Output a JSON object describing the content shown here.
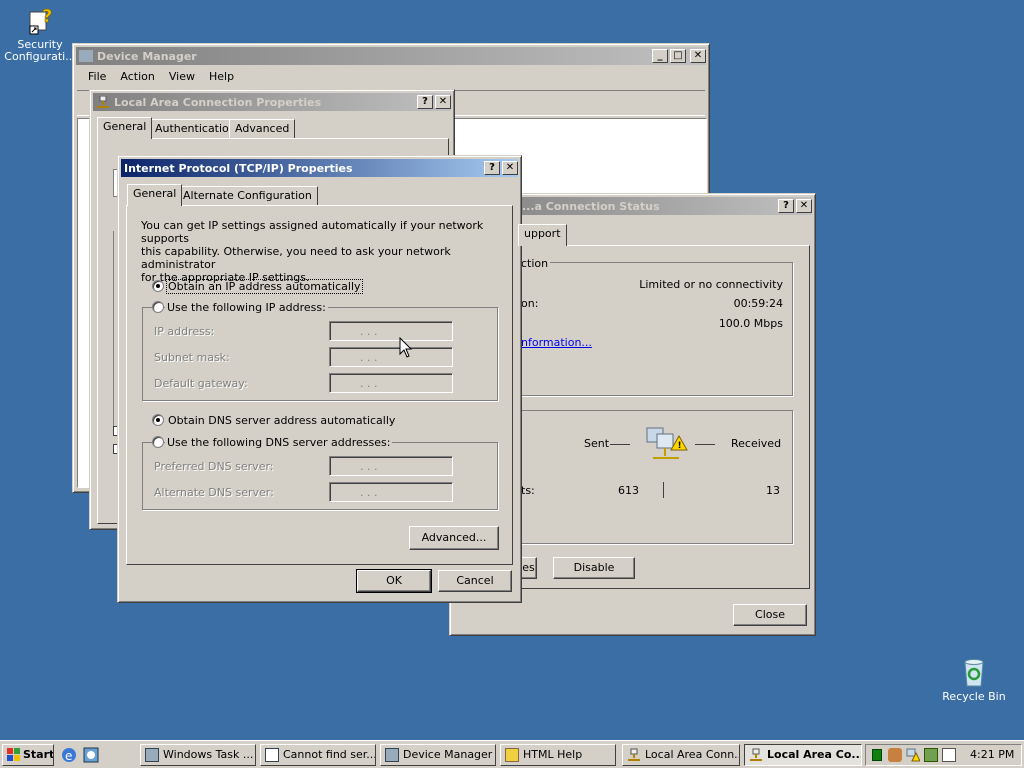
{
  "desktop": {
    "security_icon_label": "Security Configurati...",
    "recycle_label": "Recycle Bin"
  },
  "device_manager": {
    "title": "Device Manager",
    "menu": [
      "File",
      "Action",
      "View",
      "Help"
    ]
  },
  "lan_properties": {
    "title": "Local Area Connection Properties",
    "tabs": [
      "General",
      "Authentication",
      "Advanced"
    ]
  },
  "lan_status": {
    "title": "...a Connection Status",
    "tab_partial": "upport",
    "group_label_partial": "ction",
    "status_value": "Limited or no connectivity",
    "duration_label_partial": "on:",
    "duration_value": "00:59:24",
    "speed_value": "100.0 Mbps",
    "info_link_partial": "nformation...",
    "sent_label": "Sent",
    "received_label": "Received",
    "packets_label_partial": "ts:",
    "sent_value": "613",
    "received_value": "13",
    "properties_button_partial": "ies",
    "disable_button": "Disable",
    "close_button": "Close"
  },
  "tcpip": {
    "title": "Internet Protocol (TCP/IP) Properties",
    "tabs": [
      "General",
      "Alternate Configuration"
    ],
    "description": "You can get IP settings assigned automatically if your network supports this capability. Otherwise, you need to ask your network administrator for the appropriate IP settings.",
    "desc_line1": "You can get IP settings assigned automatically if your network supports",
    "desc_line2": "this capability. Otherwise, you need to ask your network administrator",
    "desc_line3": "for the appropriate IP settings.",
    "obtain_ip_auto": "Obtain an IP address automatically",
    "use_following_ip": "Use the following IP address:",
    "ip_address_label": "IP address:",
    "subnet_mask_label": "Subnet mask:",
    "default_gateway_label": "Default gateway:",
    "obtain_dns_auto": "Obtain DNS server address automatically",
    "use_following_dns": "Use the following DNS server addresses:",
    "preferred_dns_label": "Preferred DNS server:",
    "alternate_dns_label": "Alternate DNS server:",
    "ip_dots": ".       .       .",
    "advanced_button": "Advanced...",
    "ok_button": "OK",
    "cancel_button": "Cancel",
    "selected_ip_mode": "automatic",
    "selected_dns_mode": "automatic"
  },
  "taskbar": {
    "start_label": "Start",
    "items": [
      "Windows Task ...",
      "Cannot find ser...",
      "Device Manager",
      "HTML Help",
      "Local Area Conn...",
      "Local Area Co..."
    ],
    "clock": "4:21 PM"
  }
}
